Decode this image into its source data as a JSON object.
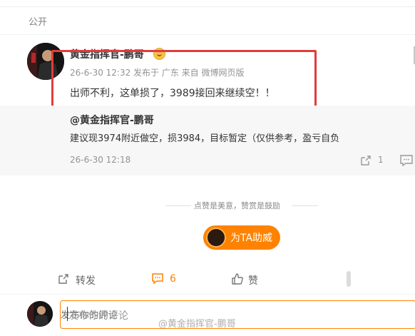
{
  "visibility": "公开",
  "post": {
    "author": "黄金指挥官-鹏哥",
    "meta": "26-6-30 12:32 发布于 广东 来自 微博网页版",
    "text": "出师不利，这单损了，3989接回来继续空！！"
  },
  "quoted": {
    "author": "@黄金指挥官-鹏哥",
    "text": "建议现3974附近做空，损3984，目标暂定（仅供参考，盈亏自负",
    "time": "26-6-30 12:18",
    "share_count": "1"
  },
  "reward": {
    "tagline": "点赞是美意，赞赏是鼓励",
    "button_label": "为TA助威"
  },
  "actions": {
    "repost_label": "转发",
    "comment_count": "6",
    "like_label": "赞"
  },
  "comment_input": {
    "placeholder": "发布你的评论"
  },
  "watermark": "@黄金指挥官-鹏哥",
  "colors": {
    "accent": "#ff8200",
    "highlight_box": "#e33b3b"
  }
}
